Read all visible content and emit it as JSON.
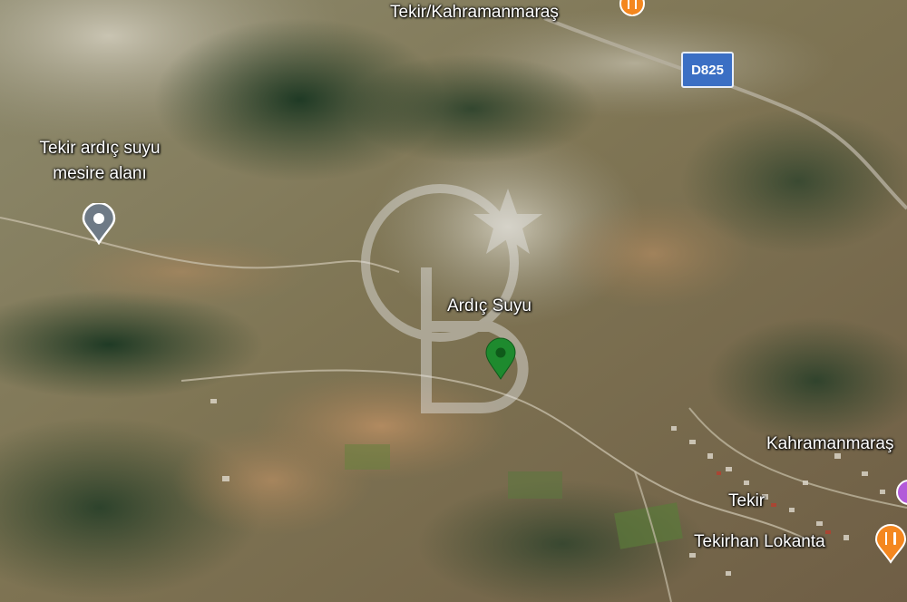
{
  "map": {
    "type": "satellite",
    "places": [
      {
        "name": "Tekir/Kahramanmaraş",
        "kind": "restaurant"
      },
      {
        "name": "Tekir ardıç suyu mesire alanı",
        "line1": "Tekir ardıç suyu",
        "line2": "mesire alanı",
        "kind": "poi"
      },
      {
        "name": "Ardıç Suyu",
        "kind": "selected-location"
      },
      {
        "name": "Kahramanmaraş",
        "display": "Kahramanmaraş",
        "kind": "town"
      },
      {
        "name": "Tekir",
        "kind": "village"
      },
      {
        "name": "Tekirhan Lokanta",
        "kind": "restaurant"
      }
    ],
    "road": {
      "label": "D825",
      "color": "#3b6fc4"
    },
    "colors": {
      "pin_green": "#1e8a2e",
      "pin_orange": "#f4871f",
      "pin_gray": "#6e7a86",
      "pin_purple": "#b35ad9"
    }
  }
}
